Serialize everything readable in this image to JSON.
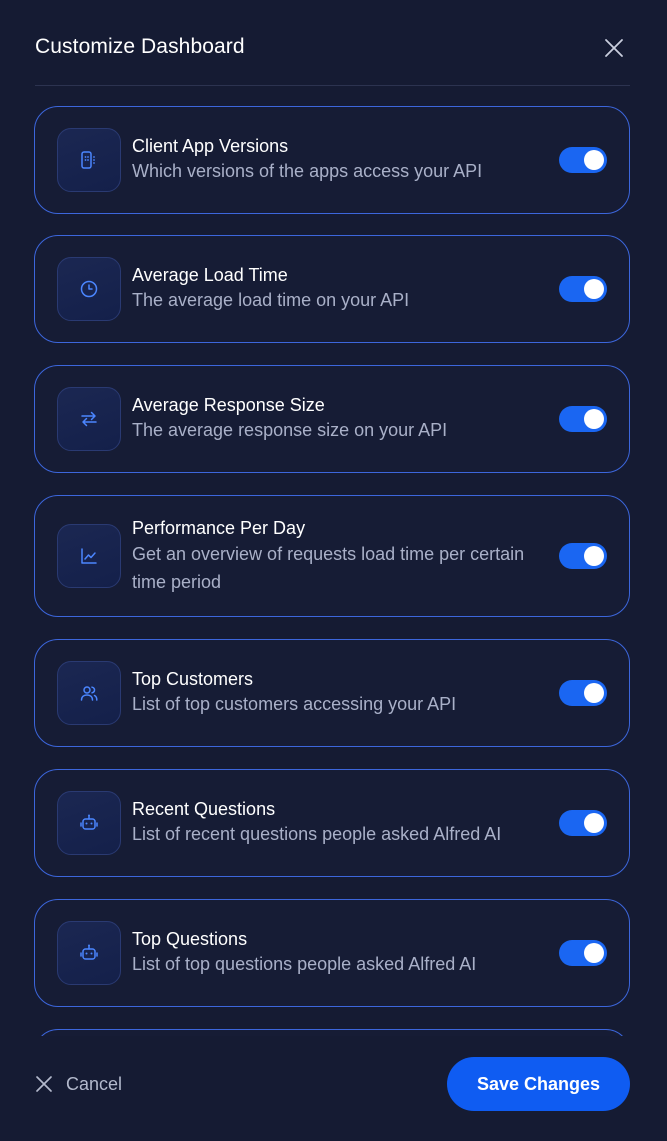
{
  "header": {
    "title": "Customize Dashboard",
    "close_icon": "close-icon"
  },
  "widgets": [
    {
      "title": "Client App Versions",
      "description": "Which versions of the apps access your API",
      "icon": "app-grid-icon",
      "enabled": true
    },
    {
      "title": "Average Load Time",
      "description": "The average load time on your API",
      "icon": "clock-icon",
      "enabled": true
    },
    {
      "title": "Average Response Size",
      "description": "The average response size on your API",
      "icon": "arrows-exchange-icon",
      "enabled": true
    },
    {
      "title": "Performance Per Day",
      "description": "Get an overview of requests load time per certain time period",
      "icon": "line-chart-icon",
      "enabled": true
    },
    {
      "title": "Top Customers",
      "description": "List of top customers accessing your API",
      "icon": "users-icon",
      "enabled": true
    },
    {
      "title": "Recent Questions",
      "description": "List of recent questions people asked Alfred AI",
      "icon": "robot-icon",
      "enabled": true
    },
    {
      "title": "Top Questions",
      "description": "List of top questions people asked Alfred AI",
      "icon": "robot-icon",
      "enabled": true
    }
  ],
  "footer": {
    "cancel_label": "Cancel",
    "save_label": "Save Changes"
  },
  "colors": {
    "background": "#151b33",
    "card_border": "#3c66dc",
    "accent": "#0f5cf2",
    "toggle_on": "#1a66f2",
    "text_primary": "#ffffff",
    "text_secondary": "#a9b0c8"
  }
}
